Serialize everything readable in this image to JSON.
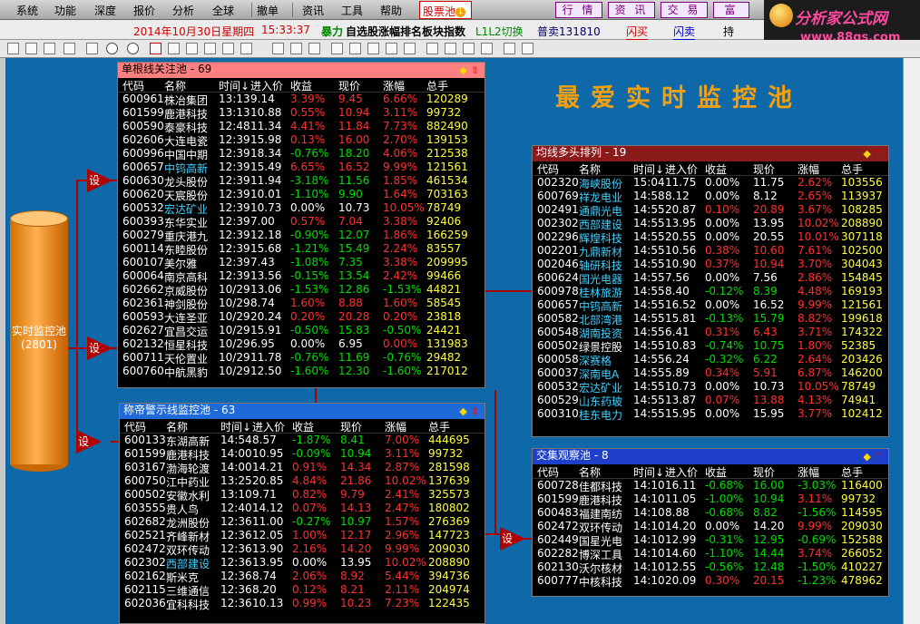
{
  "menu": [
    "系统",
    "功能",
    "深度",
    "报价",
    "分析",
    "全球",
    "撤单",
    "资讯",
    "工具",
    "帮助"
  ],
  "pool_tab": {
    "label": "股票池",
    "badge": "1"
  },
  "right_menu": [
    "行 情",
    "资 讯",
    "交 易",
    "富"
  ],
  "logo": {
    "title": "分析家公式网",
    "url": "www.88gs.com"
  },
  "infobar": {
    "date": "2014年10月30日星期四",
    "time": "15:33:37",
    "boom": "暴力",
    "title": "自选股涨幅排名板块指数",
    "l2": "L1L2切换",
    "sell": "普卖131810",
    "flash_buy": "闪买",
    "flash_sell": "闪卖",
    "hold": "持"
  },
  "big_title": "最爱实时监控池",
  "source": {
    "label": "实时监控池",
    "count": "(2801)"
  },
  "set_label": "设",
  "colors": {
    "up": "#ff3030",
    "down": "#00dd00",
    "accent": "#f0a010"
  },
  "panels": [
    {
      "title": "单根线关注池 - 69",
      "head_bg": "#ff8080",
      "head_color": "#000",
      "cols": [
        "代码",
        "名称",
        "时间↓",
        "进入价",
        "收益",
        "现价",
        "涨幅",
        "总手"
      ],
      "rows": [
        [
          "600961",
          "株冶集团",
          "13:13",
          "9.14",
          "3.39%",
          "9.45",
          "6.66%",
          "120289",
          "up"
        ],
        [
          "601599",
          "鹿港科技",
          "13:13",
          "10.88",
          "0.55%",
          "10.94",
          "3.11%",
          "99732",
          "up"
        ],
        [
          "600590",
          "泰豪科技",
          "12:48",
          "11.34",
          "4.41%",
          "11.84",
          "7.73%",
          "882490",
          "up"
        ],
        [
          "602606",
          "大连电瓷",
          "12:39",
          "15.98",
          "0.13%",
          "16.00",
          "2.70%",
          "139153",
          "up"
        ],
        [
          "600996",
          "中国中期",
          "12:39",
          "18.34",
          "-0.76%",
          "18.20",
          "4.06%",
          "212538",
          "dn"
        ],
        [
          "600657",
          "中钨高新",
          "12:39",
          "15.49",
          "6.65%",
          "16.52",
          "9.99%",
          "121561",
          "up",
          "cy"
        ],
        [
          "600630",
          "龙头股份",
          "12:39",
          "11.94",
          "-3.18%",
          "11.56",
          "1.85%",
          "461534",
          "dn"
        ],
        [
          "600620",
          "天宸股份",
          "12:39",
          "10.01",
          "-1.10%",
          "9.90",
          "1.64%",
          "703163",
          "dn"
        ],
        [
          "600532",
          "宏达矿业",
          "12:39",
          "10.73",
          "0.00%",
          "10.73",
          "10.05%",
          "78749",
          "wh",
          "cy"
        ],
        [
          "600393",
          "东华实业",
          "12:39",
          "7.00",
          "0.57%",
          "7.04",
          "3.38%",
          "92406",
          "up"
        ],
        [
          "600279",
          "重庆港九",
          "12:39",
          "12.18",
          "-0.90%",
          "12.07",
          "1.86%",
          "166259",
          "dn"
        ],
        [
          "600114",
          "东睦股份",
          "12:39",
          "15.68",
          "-1.21%",
          "15.49",
          "2.24%",
          "83557",
          "dn"
        ],
        [
          "600107",
          "美尔雅",
          "12:39",
          "7.43",
          "-1.08%",
          "7.35",
          "3.38%",
          "209995",
          "dn"
        ],
        [
          "600064",
          "南京高科",
          "12:39",
          "13.56",
          "-0.15%",
          "13.54",
          "2.42%",
          "99466",
          "dn"
        ],
        [
          "602662",
          "京威股份",
          "10/29",
          "13.06",
          "-1.53%",
          "12.86",
          "-1.53%",
          "44821",
          "dn2"
        ],
        [
          "602361",
          "神剑股份",
          "10/29",
          "8.74",
          "1.60%",
          "8.88",
          "1.60%",
          "58545",
          "up"
        ],
        [
          "600593",
          "大连圣亚",
          "10/29",
          "20.24",
          "0.20%",
          "20.28",
          "0.20%",
          "23818",
          "up"
        ],
        [
          "602627",
          "宜昌交运",
          "10/29",
          "15.91",
          "-0.50%",
          "15.83",
          "-0.50%",
          "24421",
          "dn2"
        ],
        [
          "602132",
          "恒星科技",
          "10/29",
          "6.95",
          "0.00%",
          "6.95",
          "0.00%",
          "131983",
          "wh"
        ],
        [
          "600711",
          "天伦置业",
          "10/29",
          "11.78",
          "-0.76%",
          "11.69",
          "-0.76%",
          "29482",
          "dn2"
        ],
        [
          "600760",
          "中航黑豹",
          "10/29",
          "12.50",
          "-1.60%",
          "12.30",
          "-1.60%",
          "217012",
          "dn2"
        ]
      ]
    },
    {
      "title": "均线多头排列 - 19",
      "head_bg": "#8b1a1a",
      "head_color": "#fff",
      "cols": [
        "代码",
        "名称",
        "时间↓",
        "进入价",
        "收益",
        "现价",
        "涨幅",
        "总手"
      ],
      "rows": [
        [
          "002320",
          "海峡股份",
          "15:04",
          "11.75",
          "0.00%",
          "11.75",
          "2.62%",
          "103556",
          "wh",
          "cy"
        ],
        [
          "600769",
          "祥龙电业",
          "14:58",
          "8.12",
          "0.00%",
          "8.12",
          "2.65%",
          "113937",
          "wh",
          "cy"
        ],
        [
          "002491",
          "通鼎光电",
          "14:55",
          "20.87",
          "0.10%",
          "20.89",
          "3.67%",
          "108285",
          "up",
          "cy"
        ],
        [
          "002302",
          "西部建设",
          "14:55",
          "13.95",
          "0.00%",
          "13.95",
          "10.02%",
          "208890",
          "wh",
          "cy"
        ],
        [
          "002296",
          "辉煌科技",
          "14:55",
          "20.55",
          "0.00%",
          "20.55",
          "10.01%",
          "307118",
          "wh",
          "cy"
        ],
        [
          "002201",
          "九鼎新材",
          "14:55",
          "10.56",
          "0.38%",
          "10.60",
          "7.61%",
          "102500",
          "up",
          "cy"
        ],
        [
          "002046",
          "轴研科技",
          "14:55",
          "10.90",
          "0.37%",
          "10.94",
          "3.70%",
          "304043",
          "up",
          "cy"
        ],
        [
          "600624",
          "国光电器",
          "14:55",
          "7.56",
          "0.00%",
          "7.56",
          "2.86%",
          "154845",
          "wh",
          "cy"
        ],
        [
          "600978",
          "桂林旅游",
          "14:55",
          "8.40",
          "-0.12%",
          "8.39",
          "4.48%",
          "169193",
          "dn",
          "cy"
        ],
        [
          "600657",
          "中钨高新",
          "14:55",
          "16.52",
          "0.00%",
          "16.52",
          "9.99%",
          "121561",
          "wh",
          "cy"
        ],
        [
          "600582",
          "北部湾港",
          "14:55",
          "15.81",
          "-0.13%",
          "15.79",
          "8.82%",
          "199618",
          "dn",
          "cy"
        ],
        [
          "600548",
          "湖南投资",
          "14:55",
          "6.41",
          "0.31%",
          "6.43",
          "3.71%",
          "174322",
          "up",
          "cy"
        ],
        [
          "600502",
          "绿景控股",
          "14:55",
          "10.83",
          "-0.74%",
          "10.75",
          "1.80%",
          "52385",
          "dn"
        ],
        [
          "600058",
          "深赛格",
          "14:55",
          "6.24",
          "-0.32%",
          "6.22",
          "2.64%",
          "203426",
          "dn",
          "cy"
        ],
        [
          "600037",
          "深南电A",
          "14:55",
          "5.89",
          "0.34%",
          "5.91",
          "6.87%",
          "146200",
          "up",
          "cy"
        ],
        [
          "600532",
          "宏达矿业",
          "14:55",
          "10.73",
          "0.00%",
          "10.73",
          "10.05%",
          "78749",
          "wh",
          "cy"
        ],
        [
          "600529",
          "山东药玻",
          "14:55",
          "13.87",
          "0.07%",
          "13.88",
          "4.13%",
          "74941",
          "up",
          "cy"
        ],
        [
          "600310",
          "桂东电力",
          "14:55",
          "15.95",
          "0.00%",
          "15.95",
          "3.77%",
          "102412",
          "wh",
          "cy"
        ]
      ]
    },
    {
      "title": "称帝警示线监控池 - 63",
      "head_bg": "#1e6ad8",
      "head_color": "#fff",
      "cols": [
        "代码",
        "名称",
        "时间↓",
        "进入价",
        "收益",
        "现价",
        "涨幅",
        "总手"
      ],
      "rows": [
        [
          "600133",
          "东湖高新",
          "14:54",
          "8.57",
          "-1.87%",
          "8.41",
          "7.00%",
          "444695",
          "dn"
        ],
        [
          "601599",
          "鹿港科技",
          "14:00",
          "10.95",
          "-0.09%",
          "10.94",
          "3.11%",
          "99732",
          "dn"
        ],
        [
          "603167",
          "渤海轮渡",
          "14:00",
          "14.21",
          "0.91%",
          "14.34",
          "2.87%",
          "281598",
          "up"
        ],
        [
          "600750",
          "江中药业",
          "13:25",
          "20.85",
          "4.84%",
          "21.86",
          "10.02%",
          "137639",
          "up"
        ],
        [
          "600502",
          "安徽水利",
          "13:10",
          "9.71",
          "0.82%",
          "9.79",
          "2.41%",
          "325573",
          "up"
        ],
        [
          "603555",
          "贵人鸟",
          "12:40",
          "14.12",
          "0.07%",
          "14.13",
          "2.47%",
          "180802",
          "up"
        ],
        [
          "602682",
          "龙洲股份",
          "12:36",
          "11.00",
          "-0.27%",
          "10.97",
          "1.57%",
          "276369",
          "dn"
        ],
        [
          "602521",
          "齐峰新材",
          "12:36",
          "12.05",
          "1.00%",
          "12.17",
          "2.96%",
          "147723",
          "up"
        ],
        [
          "602472",
          "双环传动",
          "12:36",
          "13.90",
          "2.16%",
          "14.20",
          "9.99%",
          "209030",
          "up"
        ],
        [
          "602302",
          "西部建设",
          "12:36",
          "13.95",
          "0.00%",
          "13.95",
          "10.02%",
          "208890",
          "wh",
          "cy"
        ],
        [
          "602162",
          "斯米克",
          "12:36",
          "8.74",
          "2.06%",
          "8.92",
          "5.44%",
          "394736",
          "up"
        ],
        [
          "602115",
          "三维通信",
          "12:36",
          "8.20",
          "0.12%",
          "8.21",
          "2.11%",
          "204974",
          "up"
        ],
        [
          "602036",
          "宜科科技",
          "12:36",
          "10.13",
          "0.99%",
          "10.23",
          "7.23%",
          "122435",
          "up"
        ]
      ]
    },
    {
      "title": "交集观察池 - 8",
      "head_bg": "#1e40c8",
      "head_color": "#fff",
      "cols": [
        "代码",
        "名称",
        "时间↓",
        "进入价",
        "收益",
        "现价",
        "涨幅",
        "总手"
      ],
      "rows": [
        [
          "600728",
          "佳都科技",
          "14:10",
          "16.11",
          "-0.68%",
          "16.00",
          "-3.03%",
          "116400",
          "dn2"
        ],
        [
          "601599",
          "鹿港科技",
          "14:10",
          "11.05",
          "-1.00%",
          "10.94",
          "3.11%",
          "99732",
          "dn"
        ],
        [
          "600483",
          "福建南纺",
          "14:10",
          "8.88",
          "-0.68%",
          "8.82",
          "-1.56%",
          "114595",
          "dn2"
        ],
        [
          "602472",
          "双环传动",
          "14:10",
          "14.20",
          "0.00%",
          "14.20",
          "9.99%",
          "209030",
          "wh"
        ],
        [
          "602449",
          "国星光电",
          "14:10",
          "12.99",
          "-0.31%",
          "12.95",
          "-0.69%",
          "152588",
          "dn2"
        ],
        [
          "602282",
          "博深工具",
          "14:10",
          "14.60",
          "-1.10%",
          "14.44",
          "3.74%",
          "266052",
          "dn"
        ],
        [
          "602130",
          "沃尔核材",
          "14:10",
          "12.55",
          "-0.56%",
          "12.48",
          "-1.50%",
          "410227",
          "dn2"
        ],
        [
          "600777",
          "中核科技",
          "14:10",
          "20.09",
          "0.30%",
          "20.15",
          "-1.23%",
          "478962",
          "up3"
        ]
      ]
    }
  ]
}
